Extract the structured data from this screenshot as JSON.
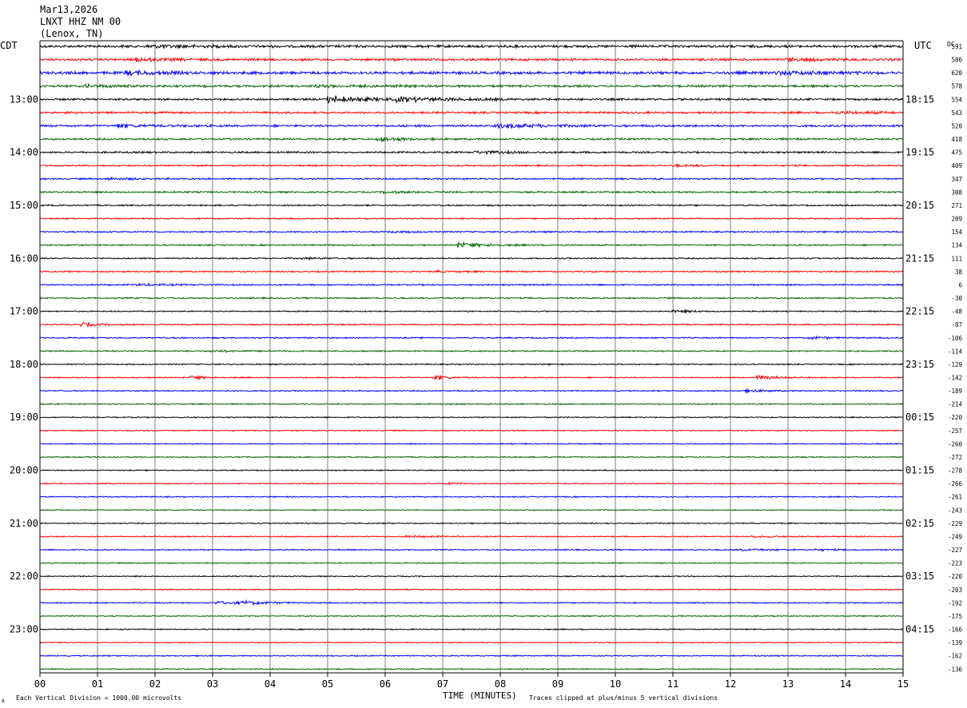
{
  "header": {
    "date": "Mar13,2026",
    "station": "LNXT HHZ NM 00",
    "location": "(Lenox, TN)"
  },
  "labels": {
    "left_zone": "CDT",
    "right_zone": "UTC",
    "dc_header": "DC",
    "xlabel": "TIME (MINUTES)",
    "scale_note": "Each Vertical Division = 1000.00 microvolts",
    "clip_note": "Traces clipped at plus/minus 5 vertical divisions",
    "corner_mark": "A"
  },
  "chart_data": {
    "type": "line",
    "title": "",
    "xlabel": "TIME (MINUTES)",
    "x_ticks": [
      "00",
      "01",
      "02",
      "03",
      "04",
      "05",
      "06",
      "07",
      "08",
      "09",
      "10",
      "11",
      "12",
      "13",
      "14",
      "15"
    ],
    "xlim": [
      0,
      15
    ],
    "grid": "vertical lines at each minute",
    "trace_colors": [
      "#000000",
      "#ff0000",
      "#0000ff",
      "#006400"
    ],
    "traces_per_hour": 4,
    "minutes_per_trace": 15,
    "left_hour_labels": [
      "13:00",
      "14:00",
      "15:00",
      "16:00",
      "17:00",
      "18:00",
      "19:00",
      "20:00",
      "21:00",
      "22:00",
      "23:00"
    ],
    "right_hour_labels": [
      "18:15",
      "19:15",
      "20:15",
      "21:15",
      "22:15",
      "23:15",
      "00:15",
      "01:15",
      "02:15",
      "03:15",
      "04:15"
    ],
    "dc_offsets": [
      "591",
      "586",
      "620",
      "578",
      "554",
      "543",
      "520",
      "418",
      "475",
      "409",
      "347",
      "308",
      "271",
      "209",
      "154",
      "134",
      "111",
      "38",
      "6",
      "-30",
      "-48",
      "-87",
      "-106",
      "-114",
      "-129",
      "-142",
      "-189",
      "-214",
      "-220",
      "-257",
      "-260",
      "-272",
      "-278",
      "-266",
      "-261",
      "-243",
      "-229",
      "-249",
      "-227",
      "-223",
      "-220",
      "-203",
      "-192",
      "-175",
      "-166",
      "-139",
      "-162",
      "-136"
    ],
    "trace_activity": [
      {
        "amp": 2.6,
        "events": [
          [
            1.9,
            2.5,
            140
          ]
        ]
      },
      {
        "amp": 2.4,
        "events": [
          [
            1.7,
            3.0,
            90
          ],
          [
            13.0,
            2.0,
            120
          ]
        ]
      },
      {
        "amp": 2.8,
        "events": [
          [
            1.5,
            3.0,
            110
          ],
          [
            12.8,
            2.5,
            200
          ]
        ]
      },
      {
        "amp": 2.2,
        "events": [
          [
            0.8,
            2.5,
            90
          ],
          [
            4.8,
            1.5,
            200
          ]
        ]
      },
      {
        "amp": 2.0,
        "events": [
          [
            5.05,
            6.5,
            100
          ],
          [
            6.2,
            4.5,
            160
          ]
        ]
      },
      {
        "amp": 2.0,
        "events": [
          [
            13.8,
            2.0,
            160
          ]
        ]
      },
      {
        "amp": 2.2,
        "events": [
          [
            1.35,
            3.0,
            90
          ],
          [
            8.0,
            3.5,
            140
          ]
        ]
      },
      {
        "amp": 1.8,
        "events": [
          [
            5.9,
            3.5,
            80
          ]
        ]
      },
      {
        "amp": 1.8,
        "events": [
          [
            7.6,
            2.5,
            110
          ]
        ]
      },
      {
        "amp": 1.6,
        "events": [
          [
            11.0,
            1.5,
            90
          ]
        ]
      },
      {
        "amp": 1.6,
        "events": [
          [
            1.2,
            1.5,
            90
          ]
        ]
      },
      {
        "amp": 1.6,
        "events": [
          [
            6.0,
            1.5,
            110
          ]
        ]
      },
      {
        "amp": 1.4,
        "events": []
      },
      {
        "amp": 1.4,
        "events": []
      },
      {
        "amp": 1.4,
        "events": [
          [
            6.1,
            1.3,
            90
          ]
        ]
      },
      {
        "amp": 1.4,
        "events": [
          [
            7.3,
            5.0,
            80
          ]
        ]
      },
      {
        "amp": 1.4,
        "events": [
          [
            4.6,
            1.5,
            70
          ]
        ]
      },
      {
        "amp": 1.4,
        "events": [
          [
            6.9,
            1.2,
            80
          ]
        ]
      },
      {
        "amp": 1.5,
        "events": [
          [
            1.7,
            1.8,
            80
          ]
        ]
      },
      {
        "amp": 1.4,
        "events": []
      },
      {
        "amp": 1.2,
        "events": [
          [
            11.0,
            2.0,
            80
          ]
        ]
      },
      {
        "amp": 1.3,
        "events": [
          [
            0.75,
            4.5,
            40
          ]
        ]
      },
      {
        "amp": 1.3,
        "events": [
          [
            13.4,
            2.5,
            60
          ]
        ]
      },
      {
        "amp": 1.3,
        "events": [
          [
            3.0,
            1.8,
            80
          ]
        ]
      },
      {
        "amp": 1.2,
        "events": []
      },
      {
        "amp": 1.2,
        "events": [
          [
            2.65,
            4.0,
            40
          ],
          [
            6.9,
            4.5,
            40
          ],
          [
            12.5,
            4.5,
            50
          ]
        ]
      },
      {
        "amp": 1.2,
        "events": [
          [
            12.3,
            2.5,
            60
          ]
        ]
      },
      {
        "amp": 1.2,
        "events": []
      },
      {
        "amp": 1.1,
        "events": []
      },
      {
        "amp": 1.1,
        "events": []
      },
      {
        "amp": 1.1,
        "events": []
      },
      {
        "amp": 1.1,
        "events": []
      },
      {
        "amp": 1.1,
        "events": []
      },
      {
        "amp": 1.1,
        "events": [
          [
            7.1,
            1.5,
            80
          ]
        ]
      },
      {
        "amp": 1.1,
        "events": []
      },
      {
        "amp": 1.1,
        "events": []
      },
      {
        "amp": 1.1,
        "events": []
      },
      {
        "amp": 1.1,
        "events": [
          [
            6.4,
            1.5,
            100
          ],
          [
            12.4,
            1.5,
            80
          ]
        ]
      },
      {
        "amp": 1.2,
        "events": [
          [
            12.2,
            1.8,
            100
          ],
          [
            13.5,
            1.5,
            60
          ]
        ]
      },
      {
        "amp": 1.1,
        "events": []
      },
      {
        "amp": 1.1,
        "events": []
      },
      {
        "amp": 1.1,
        "events": []
      },
      {
        "amp": 1.2,
        "events": [
          [
            3.1,
            3.0,
            90
          ],
          [
            3.55,
            4.0,
            70
          ]
        ]
      },
      {
        "amp": 1.1,
        "events": []
      },
      {
        "amp": 1.1,
        "events": []
      },
      {
        "amp": 1.1,
        "events": []
      },
      {
        "amp": 1.1,
        "events": []
      },
      {
        "amp": 1.1,
        "events": []
      }
    ]
  }
}
